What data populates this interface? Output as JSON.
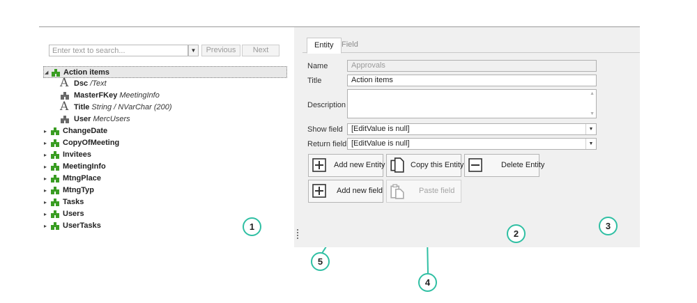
{
  "search": {
    "placeholder": "Enter text to search...",
    "previous_label": "Previous",
    "next_label": "Next"
  },
  "tree": {
    "root": {
      "label": "Action items"
    },
    "children": [
      {
        "label": "Dsc",
        "type": "/Text",
        "icon": "text-A-icon"
      },
      {
        "label": "MasterFKey",
        "type": "MeetingInfo",
        "icon": "puzzle-grey-icon"
      },
      {
        "label": "Title",
        "type": "String / NVarChar (200)",
        "icon": "text-A-icon"
      },
      {
        "label": "User",
        "type": "MercUsers",
        "icon": "puzzle-grey-icon"
      }
    ],
    "entities": [
      "ChangeDate",
      "CopyOfMeeting",
      "Invitees",
      "MeetingInfo",
      "MtngPlace",
      "MtngTyp",
      "Tasks",
      "Users",
      "UserTasks"
    ]
  },
  "tabs": [
    {
      "label": "Entity"
    },
    {
      "label": "Field"
    }
  ],
  "form": {
    "name_label": "Name",
    "name_value": "Approvals",
    "title_label": "Title",
    "title_value": "Action items",
    "description_label": "Description",
    "description_value": "",
    "show_field_label": "Show field",
    "show_field_value": "[EditValue is null]",
    "return_field_label": "Return field",
    "return_field_value": "[EditValue is null]"
  },
  "buttons": {
    "add_entity": "Add new Entity",
    "copy_entity": "Copy this Entity",
    "delete_entity": "Delete Entity",
    "add_field": "Add new field",
    "paste_field": "Paste field"
  },
  "callouts": [
    "1",
    "2",
    "3",
    "4",
    "5"
  ],
  "colors": {
    "puzzle_green": "#3a9d23",
    "puzzle_grey": "#6a6a6a",
    "callout_teal": "#2fbfa3"
  }
}
